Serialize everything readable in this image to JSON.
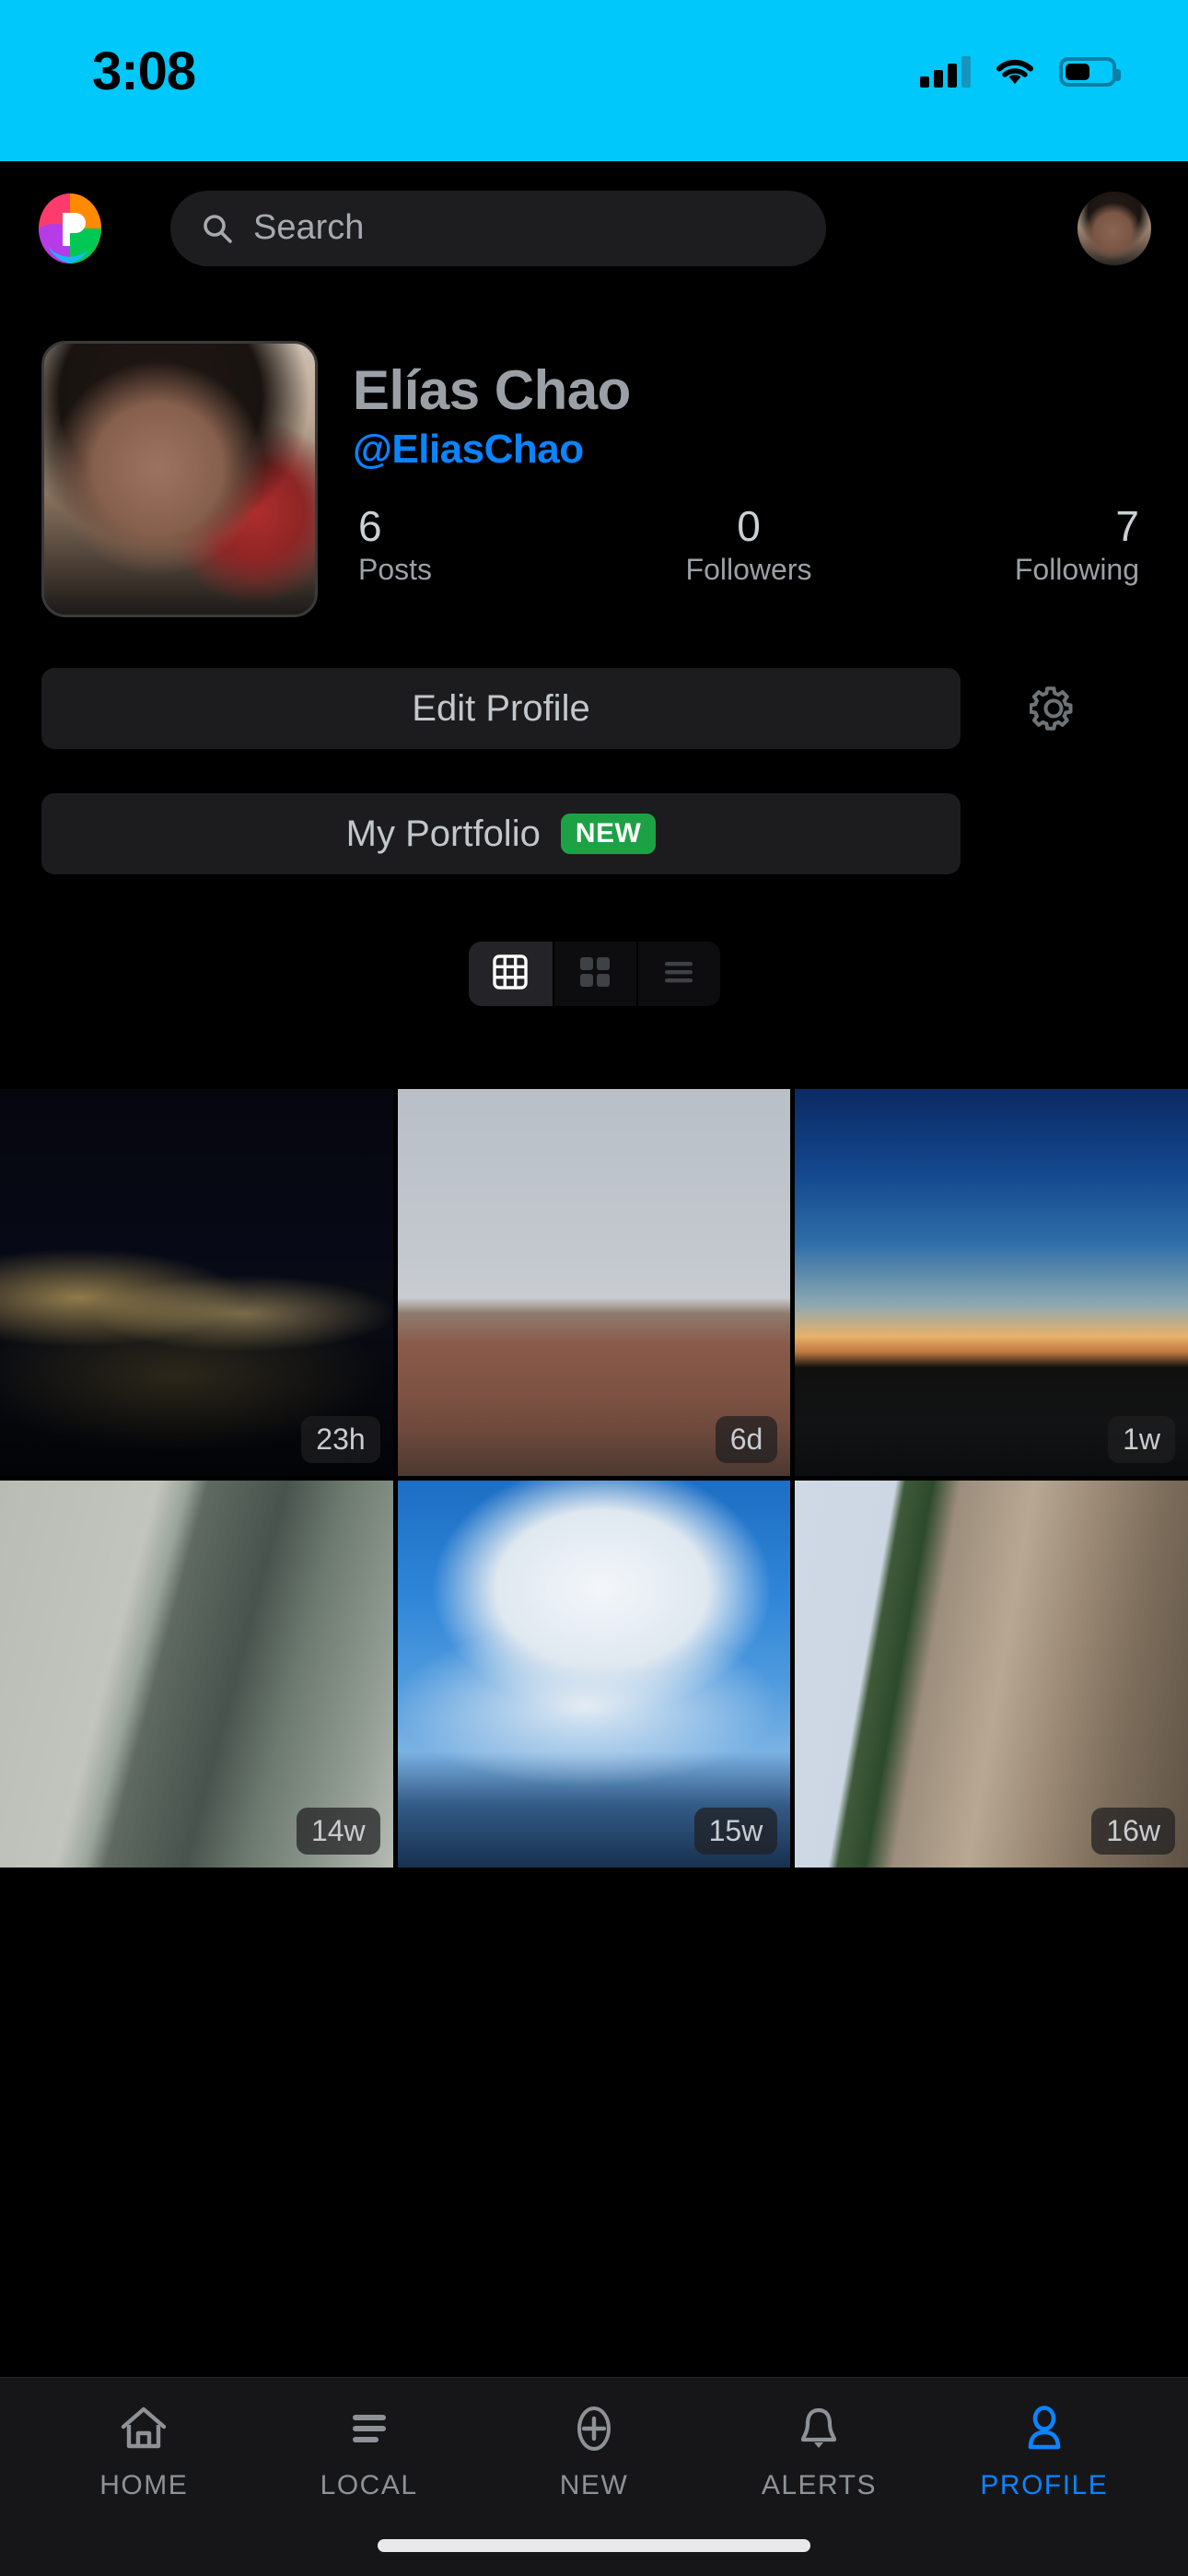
{
  "status_bar": {
    "time": "3:08",
    "background_color": "#00C8FB",
    "signal_icon": "cellular-bars-icon",
    "wifi_icon": "wifi-icon",
    "battery_icon": "battery-icon",
    "battery_level_percent": 55
  },
  "app_nav": {
    "logo_icon": "pixelfed-logo-icon",
    "search": {
      "icon": "search-icon",
      "placeholder": "Search",
      "value": ""
    },
    "avatar_icon": "user-avatar-icon"
  },
  "profile": {
    "avatar_icon": "profile-photo",
    "display_name": "Elías Chao",
    "handle": "@EliasChao",
    "accent_color": "#0A84FF",
    "stats": [
      {
        "count": "6",
        "label": "Posts"
      },
      {
        "count": "0",
        "label": "Followers"
      },
      {
        "count": "7",
        "label": "Following"
      }
    ]
  },
  "actions": {
    "edit_profile_label": "Edit Profile",
    "settings_icon": "gear-icon",
    "portfolio_label": "My Portfolio",
    "portfolio_badge": "NEW",
    "badge_color": "#1CA244"
  },
  "view_toggles": [
    {
      "name": "grid-3x3",
      "icon": "grid-3x3-icon",
      "active": true
    },
    {
      "name": "grid-2x2",
      "icon": "grid-2x2-icon",
      "active": false
    },
    {
      "name": "list-view",
      "icon": "list-view-icon",
      "active": false
    }
  ],
  "grid": {
    "posts": [
      {
        "id": "post-1",
        "art": "img-night",
        "timestamp": "23h",
        "description": "night city skyline reflected on water"
      },
      {
        "id": "post-2",
        "art": "img-palace",
        "timestamp": "6d",
        "description": "palace facade with mexican flag"
      },
      {
        "id": "post-3",
        "art": "img-sunset",
        "timestamp": "1w",
        "description": "sunset over rooftop buildings"
      },
      {
        "id": "post-4",
        "art": "img-tower",
        "timestamp": "14w",
        "description": "glass skyscraper from below"
      },
      {
        "id": "post-5",
        "art": "img-clouds",
        "timestamp": "15w",
        "description": "cumulus clouds above city towers"
      },
      {
        "id": "post-6",
        "art": "img-facade",
        "timestamp": "16w",
        "description": "ornate stone building facade"
      }
    ]
  },
  "tab_bar": {
    "items": [
      {
        "label": "HOME",
        "icon": "home-icon",
        "active": false
      },
      {
        "label": "LOCAL",
        "icon": "list-lines-icon",
        "active": false
      },
      {
        "label": "NEW",
        "icon": "plus-circle-icon",
        "active": false
      },
      {
        "label": "ALERTS",
        "icon": "bell-icon",
        "active": false
      },
      {
        "label": "PROFILE",
        "icon": "person-icon",
        "active": true
      }
    ],
    "active_color": "#0A84FF",
    "inactive_color": "#8E9297",
    "home_indicator": "home-indicator"
  }
}
